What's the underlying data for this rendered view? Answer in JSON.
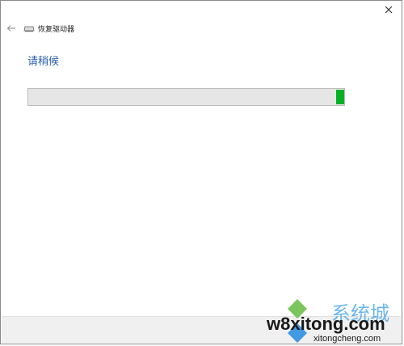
{
  "window": {
    "title": "恢复驱动器",
    "heading": "请稍候",
    "close_icon": "close-icon",
    "back_icon": "back-arrow-icon",
    "drive_icon": "drive-icon"
  },
  "progress": {
    "value": 0.98,
    "color": "#06b025"
  },
  "watermark": {
    "main": "w8xitong.com",
    "sub": "xitongcheng.com",
    "chars": "系统城"
  },
  "colors": {
    "heading": "#2a5ea8",
    "footer": "#f0f0f0"
  }
}
